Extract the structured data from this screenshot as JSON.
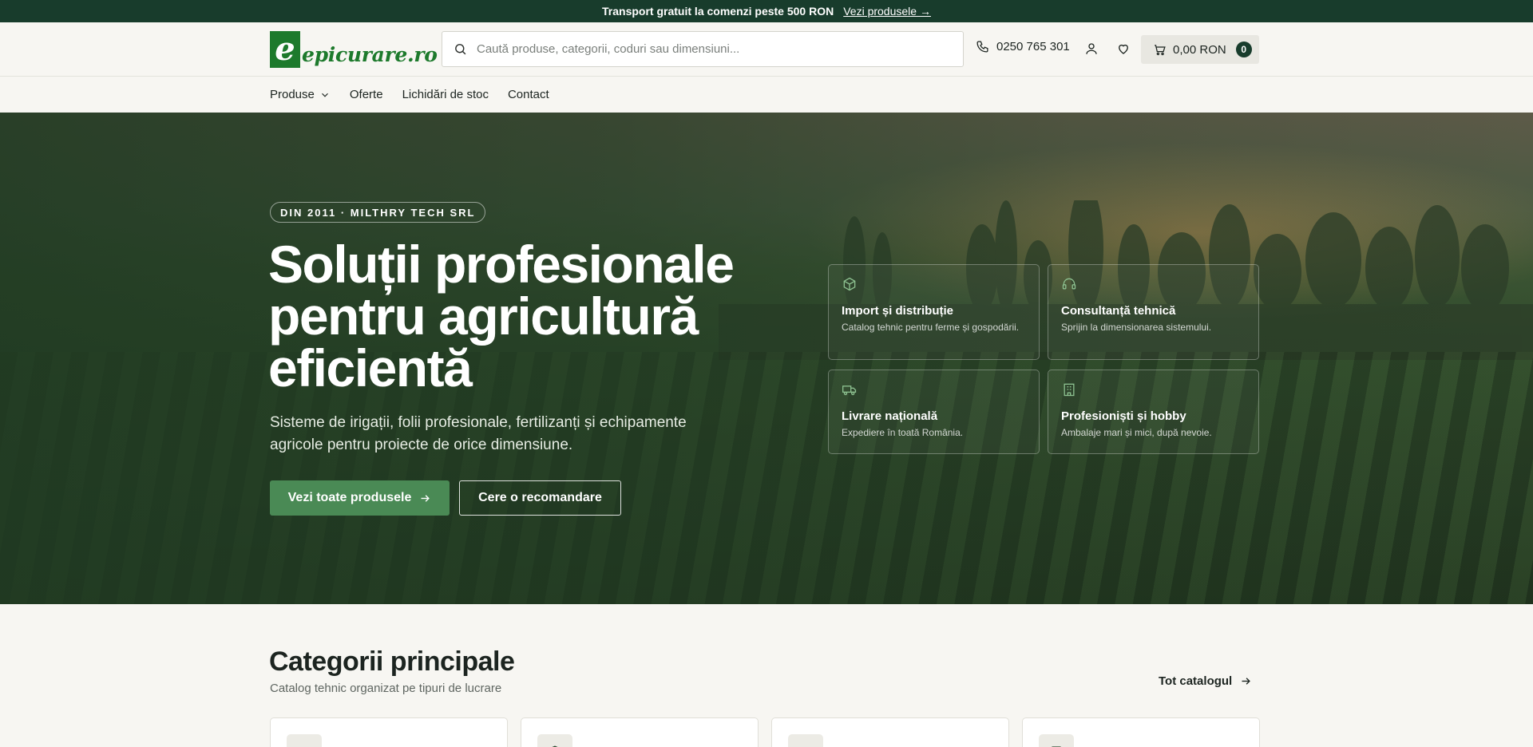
{
  "announcement": {
    "text": "Transport gratuit la comenzi peste 500 RON",
    "link": "Vezi produsele →"
  },
  "header": {
    "logo_mark": "e",
    "logo_text": "epicurare.ro",
    "search_placeholder": "Caută produse, categorii, coduri sau dimensiuni...",
    "phone": "0250 765 301",
    "cart_total": "0,00 RON",
    "cart_count": "0"
  },
  "nav": {
    "items": [
      "Produse",
      "Oferte",
      "Lichidări de stoc",
      "Contact"
    ]
  },
  "hero": {
    "badge": "DIN 2011 · MILTHRY TECH SRL",
    "title": "Soluții profesionale pentru agricultură eficientă",
    "subtitle": "Sisteme de irigații, folii profesionale, fertilizanți și echipamente agricole pentru proiecte de orice dimensiune.",
    "primary_cta": "Vezi toate produsele",
    "secondary_cta": "Cere o recomandare",
    "features": [
      {
        "icon": "box-icon",
        "title": "Import și distribuție",
        "text": "Catalog tehnic pentru ferme și gospodării."
      },
      {
        "icon": "headset-icon",
        "title": "Consultanță tehnică",
        "text": "Sprijin la dimensionarea sistemului."
      },
      {
        "icon": "truck-icon",
        "title": "Livrare națională",
        "text": "Expediere în toată România."
      },
      {
        "icon": "building-icon",
        "title": "Profesioniști și hobby",
        "text": "Ambalaje mari și mici, după nevoie."
      }
    ]
  },
  "categories": {
    "title": "Categorii principale",
    "subtitle": "Catalog tehnic organizat pe tipuri de lucrare",
    "link": "Tot catalogul"
  },
  "colors": {
    "brand_green": "#1d7a2c",
    "dark_green": "#183c2c",
    "cta_green": "#4a8a55"
  }
}
